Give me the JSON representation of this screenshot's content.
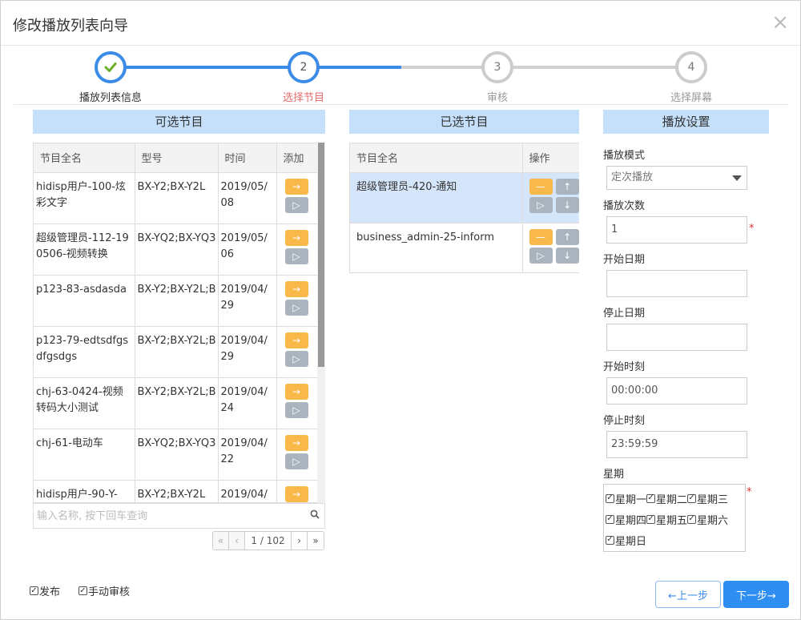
{
  "dialog": {
    "title": "修改播放列表向导",
    "close": "×"
  },
  "steps": [
    {
      "num": "",
      "label": "播放列表信息",
      "state": "done"
    },
    {
      "num": "2",
      "label": "选择节目",
      "state": "current"
    },
    {
      "num": "3",
      "label": "审核",
      "state": "todo"
    },
    {
      "num": "4",
      "label": "选择屏幕",
      "state": "todo"
    }
  ],
  "available": {
    "header": "可选节目",
    "columns": [
      "节目全名",
      "型号",
      "时间",
      "添加"
    ],
    "rows": [
      {
        "name": "hidisp用户-100-炫彩文字",
        "model": "BX-Y2;BX-Y2L",
        "time": "2019/05/08"
      },
      {
        "name": "超级管理员-112-190506-视频转换",
        "model": "BX-YQ2;BX-YQ3",
        "time": "2019/05/06"
      },
      {
        "name": "p123-83-asdasda",
        "model": "BX-Y2;BX-Y2L;B",
        "time": "2019/04/29"
      },
      {
        "name": "p123-79-edtsdfgsdfgsdgs",
        "model": "BX-Y2;BX-Y2L;B",
        "time": "2019/04/29"
      },
      {
        "name": "chj-63-0424-视频转码大小测试",
        "model": "BX-Y2;BX-Y2L;B",
        "time": "2019/04/24"
      },
      {
        "name": "chj-61-电动车",
        "model": "BX-YQ2;BX-YQ3",
        "time": "2019/04/22"
      },
      {
        "name": "hidisp用户-90-Y-",
        "model": "BX-Y2;BX-Y2L",
        "time": "2019/04/"
      }
    ],
    "add_icon": "→",
    "play_icon": "▷",
    "search_placeholder": "输入名称, 按下回车查询",
    "pager": {
      "first": "«",
      "prev": "‹",
      "page": "1 / 102",
      "next": "›",
      "last": "»"
    }
  },
  "selected": {
    "header": "已选节目",
    "columns": [
      "节目全名",
      "操作"
    ],
    "rows": [
      {
        "name": "超级管理员-420-通知"
      },
      {
        "name": "business_admin-25-inform"
      }
    ],
    "remove_icon": "—",
    "up_icon": "↑",
    "play_icon": "▷",
    "down_icon": "↓"
  },
  "settings": {
    "header": "播放设置",
    "mode_label": "播放模式",
    "mode_value": "定次播放",
    "count_label": "播放次数",
    "count_value": "1",
    "start_date_label": "开始日期",
    "start_date_value": "",
    "stop_date_label": "停止日期",
    "stop_date_value": "",
    "start_time_label": "开始时刻",
    "start_time_value": "00:00:00",
    "stop_time_label": "停止时刻",
    "stop_time_value": "23:59:59",
    "week_label": "星期",
    "week_days": [
      "星期一",
      "星期二",
      "星期三",
      "星期四",
      "星期五",
      "星期六",
      "星期日"
    ],
    "required_mark": "*"
  },
  "footer": {
    "publish_label": "发布",
    "manual_review_label": "手动审核",
    "prev_label": "←上一步",
    "next_label": "下一步→"
  },
  "colors": {
    "accent": "#2e8ef2",
    "panel_head": "#c5e0fb",
    "orange": "#f9b94a",
    "current_step": "#e46b6b"
  }
}
